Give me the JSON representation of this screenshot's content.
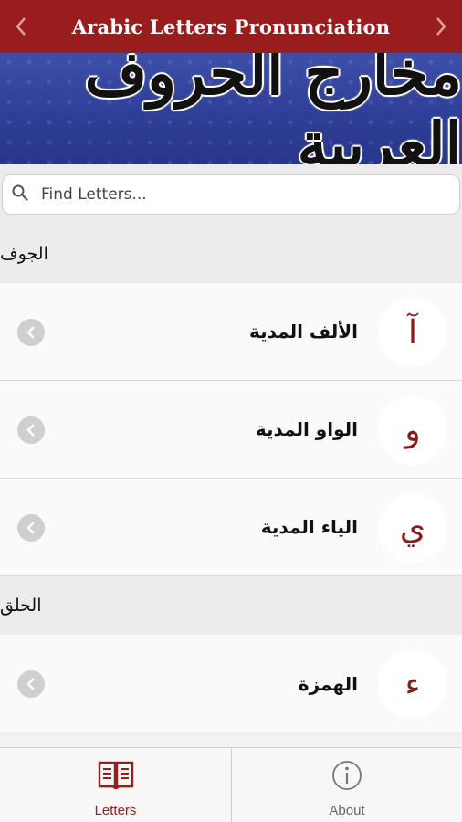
{
  "nav": {
    "title": "Arabic Letters Pronunciation",
    "back_icon": "chevron-left-icon",
    "forward_icon": "chevron-right-icon",
    "bar_color": "#9a1d1d"
  },
  "banner": {
    "text": "مخارج الحروف العربية",
    "background_color": "#2f3f97"
  },
  "search": {
    "placeholder": "Find Letters...",
    "value": ""
  },
  "sections": [
    {
      "header": "الجوف",
      "rows": [
        {
          "letter": "آ",
          "label": "الألف المدية"
        },
        {
          "letter": "و",
          "label": "الواو المدية"
        },
        {
          "letter": "ي",
          "label": "الياء المدية"
        }
      ]
    },
    {
      "header": "الحلق",
      "rows": [
        {
          "letter": "ء",
          "label": "الهمزة"
        }
      ]
    }
  ],
  "tabs": [
    {
      "label": "Letters",
      "icon": "book-icon",
      "active": true
    },
    {
      "label": "About",
      "icon": "info-icon",
      "active": false
    }
  ],
  "colors": {
    "accent": "#9a1d1d",
    "letter": "#8b1a1a"
  }
}
